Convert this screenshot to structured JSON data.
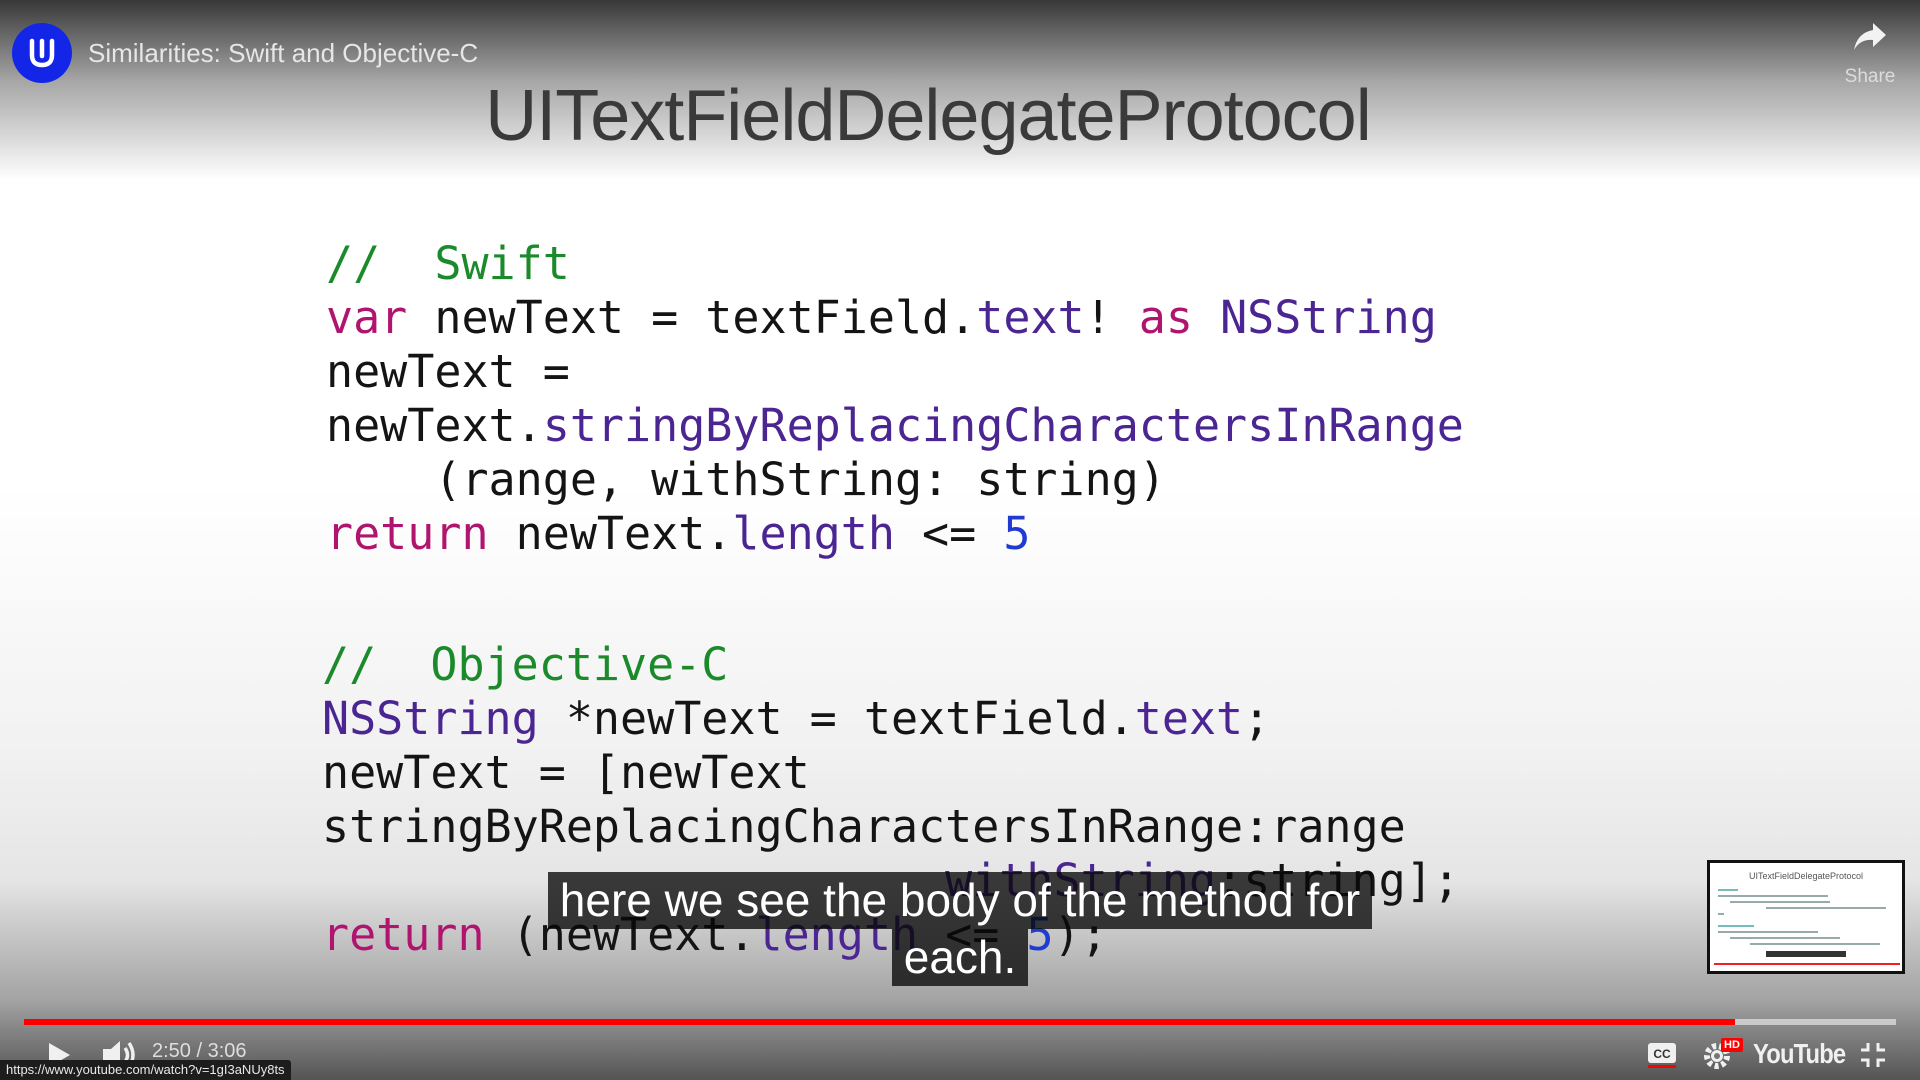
{
  "channel": {
    "logo_icon": "udacity-logo-icon",
    "brand_color": "#1326e8"
  },
  "video": {
    "title": "Similarities: Swift and Objective-C"
  },
  "share": {
    "label": "Share",
    "icon": "share-arrow-icon"
  },
  "slide": {
    "title": "UITextFieldDelegateProtocol",
    "swift_lines": [
      [
        {
          "t": "//  Swift",
          "c": "cm"
        }
      ],
      [
        {
          "t": "var",
          "c": "kw"
        },
        {
          "t": " newText = textField.",
          "c": "pl"
        },
        {
          "t": "text",
          "c": "pr"
        },
        {
          "t": "! ",
          "c": "pl"
        },
        {
          "t": "as",
          "c": "kw"
        },
        {
          "t": " ",
          "c": "pl"
        },
        {
          "t": "NSString",
          "c": "ty"
        }
      ],
      [
        {
          "t": "newText =",
          "c": "pl"
        }
      ],
      [
        {
          "t": "newText.",
          "c": "pl"
        },
        {
          "t": "stringByReplacingCharactersInRange",
          "c": "pr"
        }
      ],
      [
        {
          "t": "    (range, withString: string)",
          "c": "pl"
        }
      ],
      [
        {
          "t": "return",
          "c": "kw"
        },
        {
          "t": " newText.",
          "c": "pl"
        },
        {
          "t": "length",
          "c": "pr"
        },
        {
          "t": " <= ",
          "c": "pl"
        },
        {
          "t": "5",
          "c": "nu"
        }
      ]
    ],
    "objc_lines": [
      [
        {
          "t": "//  Objective-C",
          "c": "cm"
        }
      ],
      [
        {
          "t": "NSString",
          "c": "ty"
        },
        {
          "t": " *newText = textField.",
          "c": "pl"
        },
        {
          "t": "text",
          "c": "pr"
        },
        {
          "t": ";",
          "c": "pl"
        }
      ],
      [
        {
          "t": "newText = [newText",
          "c": "pl"
        }
      ],
      [
        {
          "t": "stringByReplacingCharactersInRange:range",
          "c": "pl"
        }
      ],
      [
        {
          "t": "                       ",
          "c": "pl"
        },
        {
          "t": "withString",
          "c": "pr"
        },
        {
          "t": ":string];",
          "c": "pl"
        }
      ],
      [
        {
          "t": "return",
          "c": "kw"
        },
        {
          "t": " (newText.",
          "c": "pl"
        },
        {
          "t": "length",
          "c": "pr"
        },
        {
          "t": " <= ",
          "c": "pl"
        },
        {
          "t": "5",
          "c": "nu"
        },
        {
          "t": ");",
          "c": "pl"
        }
      ]
    ]
  },
  "captions": {
    "line1": "here we see the body of the method for",
    "line2": "each."
  },
  "thumbnail": {
    "title": "UITextFieldDelegateProtocol"
  },
  "player": {
    "progress_fraction": 0.914,
    "current_time": "2:50",
    "duration": "3:06",
    "time_display": "2:50 / 3:06",
    "play_icon": "play-icon",
    "volume_icon": "volume-icon",
    "cc_icon": "closed-captions-icon",
    "settings_icon": "settings-gear-icon",
    "settings_badge": "HD",
    "brand_label": "YouTube",
    "fullscreen_icon": "exit-fullscreen-icon",
    "progress_color": "#ff0000"
  },
  "status_bar": {
    "url": "https://www.youtube.com/watch?v=1gI3aNUy8ts"
  }
}
